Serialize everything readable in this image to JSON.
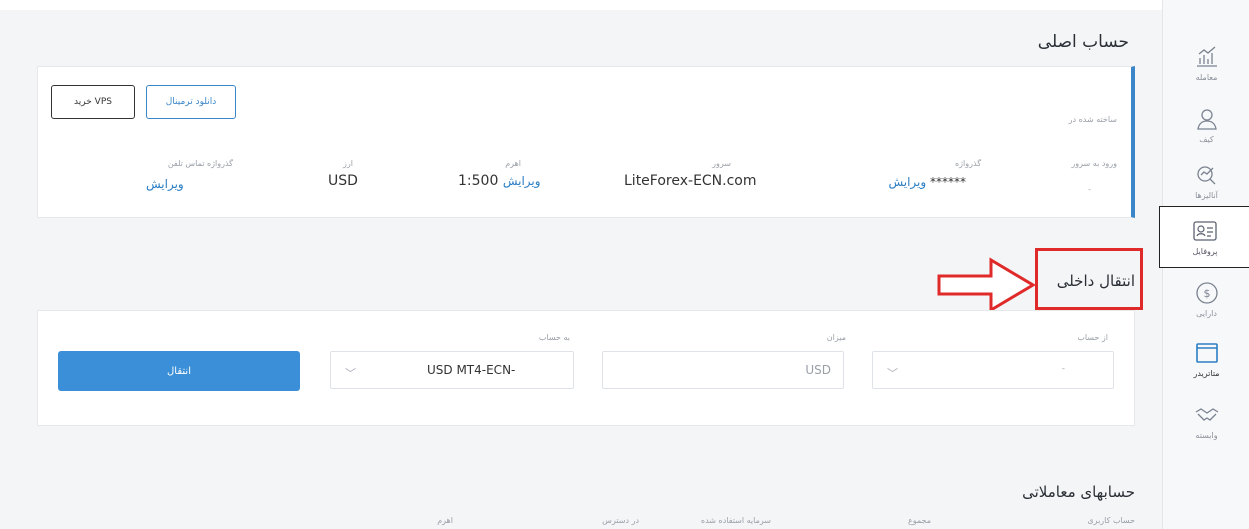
{
  "sidebar": {
    "items": [
      {
        "label": "معامله",
        "icon": "chart-icon"
      },
      {
        "label": "کیف",
        "icon": "user-icon"
      },
      {
        "label": "آنالیزها",
        "icon": "analysis-icon"
      },
      {
        "label": "پروفایل",
        "icon": "profile-card-icon"
      },
      {
        "label": "دارایی",
        "icon": "dollar-icon"
      },
      {
        "label": "متاتریدر",
        "icon": "window-icon"
      },
      {
        "label": "وابسته",
        "icon": "handshake-icon"
      }
    ]
  },
  "main_account": {
    "title": "حساب اصلی",
    "buy_vps": "خرید VPS",
    "download_terminal": "دانلود ترمینال",
    "created_in": "ساخته شده در",
    "fields": {
      "login": {
        "label": "ورود به سرور",
        "value": "-"
      },
      "password": {
        "label": "گذرواژه",
        "value": "******",
        "edit": "ویرایش"
      },
      "server": {
        "label": "سرور",
        "value": "LiteForex-ECN.com"
      },
      "leverage": {
        "label": "اهرم",
        "value": "1:500",
        "edit": "ویرایش"
      },
      "currency": {
        "label": "ارز",
        "value": "USD"
      },
      "phone_password": {
        "label": "گذرواژه تماس تلفن",
        "edit": "ویرایش"
      }
    }
  },
  "transfer": {
    "title": "انتقال داخلی",
    "from_label": "از حساب",
    "from_value": "-",
    "amount_label": "میزان",
    "amount_placeholder": "USD",
    "to_label": "به حساب",
    "to_value": "USD MT4-ECN-",
    "submit": "انتقال"
  },
  "trading_accounts": {
    "title": "حسابهای معاملاتی",
    "columns": [
      "حساب کاربری",
      "مجموع",
      "سرمایه استفاده شده",
      "در دسترس",
      "اهرم"
    ]
  },
  "colors": {
    "accent": "#3b8fd8",
    "highlight": "#e02a2a"
  }
}
